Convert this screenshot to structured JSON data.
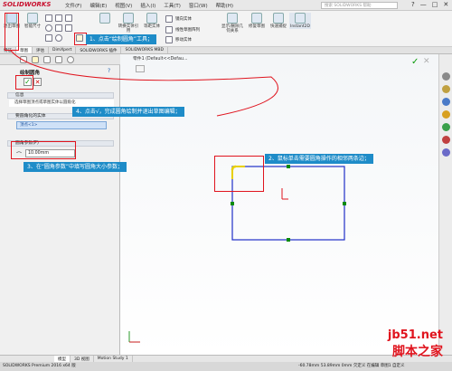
{
  "app": {
    "logo": "SOLIDWORKS",
    "menus": [
      "文件(F)",
      "编辑(E)",
      "视图(V)",
      "插入(I)",
      "工具(T)",
      "窗口(W)",
      "帮助(H)"
    ],
    "search_placeholder": "搜索 SOLIDWORKS 帮助",
    "window_buttons": [
      "?",
      "—",
      "□",
      "✕"
    ]
  },
  "ribbon": {
    "exit_sketch": "退出草图",
    "smart_dim": "智能尺寸",
    "mirror": "镜向实体",
    "linear_array": "线性草图阵列",
    "convert": "转换实体引用",
    "offset": "等距实体",
    "move": "移动实体",
    "display_relations": "显示/删除几何关系",
    "repair_sketch": "修复草图",
    "quick_snap": "快速捕捉",
    "instant2d": "Instant2D"
  },
  "tabs": [
    "特征",
    "草图",
    "评估",
    "DimXpert",
    "SOLIDWORKS 插件",
    "SOLIDWORKS MBD"
  ],
  "panel": {
    "title": "绘制圆角",
    "message_header": "信息",
    "message_text": "选择草图顶点或草图实体以圆角化",
    "entities_header": "要圆角化的实体",
    "entities_item": "顶点<1>",
    "params_header": "圆角参数(P)",
    "radius_value": "10.00mm"
  },
  "canvas": {
    "breadcrumb": "零件1 (Default<<Defau..."
  },
  "bottom_tabs": [
    "模型",
    "3D 视图",
    "Motion Study 1"
  ],
  "status": {
    "left": "SOLIDWORKS Premium 2016 x64 版",
    "right": "-60.78mm  53.89mm  0mm  欠定义  在编辑 草图1  自定义"
  },
  "callouts": {
    "c1": "1、点击“绘制圆角”工具；",
    "c2": "2、鼠标单击需要圆角操作的相邻两条边；",
    "c3": "3、在“圆角参数”中填写圆角大小参数；",
    "c4": "4、点击√，完成圆角绘制并退出草图编辑；"
  },
  "watermark": {
    "url": "jb51.net",
    "name": "脚本之家"
  },
  "colors": {
    "callout_bg": "#1e8cc8",
    "highlight_red": "#e0141e",
    "sketch_blue": "#2030c8",
    "point_green": "#0a8a0a",
    "fillet_yellow": "#e8d000"
  }
}
